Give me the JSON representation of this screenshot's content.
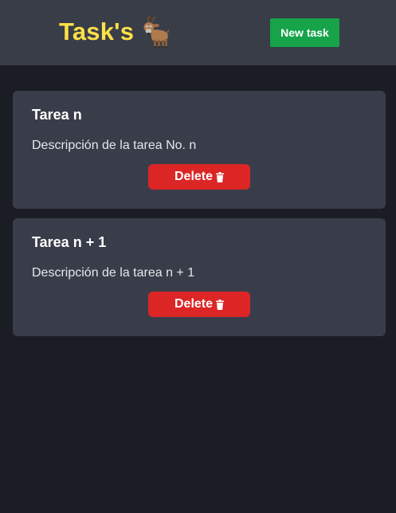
{
  "header": {
    "logo_text": "Task's",
    "logo_icon": "goat-icon",
    "new_task_label": "New task"
  },
  "colors": {
    "header_bg": "#383d48",
    "page_bg": "#1b1d25",
    "card_bg": "#393d4a",
    "logo": "#fde047",
    "new_task": "#16a34a",
    "delete": "#dc2626"
  },
  "tasks": [
    {
      "title": "Tarea n",
      "description": "Descripción de la tarea No. n",
      "delete_label": "Delete",
      "delete_icon": "trash-icon"
    },
    {
      "title": "Tarea n + 1",
      "description": "Descripción de la tarea n + 1",
      "delete_label": "Delete",
      "delete_icon": "trash-icon"
    }
  ]
}
